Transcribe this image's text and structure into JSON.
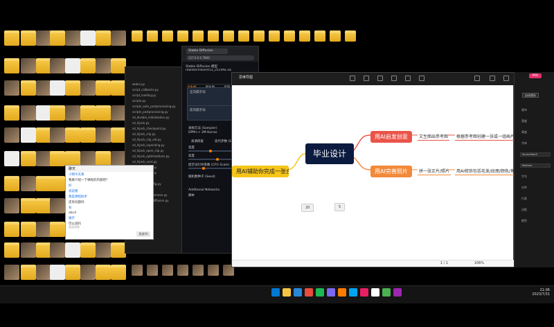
{
  "sd_window": {
    "tab_title": "Stable Diffusion",
    "url": "127.0.0.1:7860",
    "model_label": "Stable Diffusion 模型",
    "model_value": "realisticVisionV51_v51VAE.safetensors [15012c538f]",
    "tabs": [
      "文生图",
      "图生图",
      "后期"
    ],
    "prompt_label": "正向提示词",
    "neg_label": "反向提示词",
    "sampler_label": "采样方法 (Sampler)",
    "sampler_value": "DPM++ 2M Karras",
    "steps_label": "迭代步数 (Steps)",
    "hires_label": "高清修复",
    "refiner_label": "Refiner",
    "width_label": "宽度",
    "height_label": "高度",
    "cfg_label": "提示词引导系数 (CFG Scale)",
    "seed_label": "随机数种子 (Seed)",
    "addnet_label": "Additional Networks",
    "script_label": "脚本"
  },
  "chat": {
    "title": "聊天",
    "lines": [
      {
        "text": "小明今天真",
        "blue": true
      },
      {
        "text": "我来介绍一下课程的内容吧？",
        "blue": false
      },
      {
        "text": "好",
        "blue": true
      },
      {
        "text": "说说看",
        "blue": true
      },
      {
        "text": "我是课程助手",
        "blue": true
      },
      {
        "text": "还有问题吗",
        "blue": false
      },
      {
        "text": "有",
        "blue": true
      },
      {
        "text": "abcd",
        "blue": false
      },
      {
        "text": "展示",
        "blue": true
      },
      {
        "text": "可以说吗",
        "blue": false
      }
    ],
    "input_hint": "发送消息",
    "send_label": "发送(S)"
  },
  "mindmap": {
    "title": "思维导图",
    "center": "毕业设计",
    "left_node": "用AI辅助你完成一张合成",
    "branch1": "用AI启发创意",
    "branch1_sub1": "文生图出参考图",
    "branch1_sub2": "根据参考图创建一张或一组画片",
    "branch2": "用AI完善照片",
    "branch2_sub1": "拼一张正片/照片",
    "branch2_sub2": "用AI修饰包括毛发/纹理/颜色/角",
    "marker1": "20",
    "marker2": "5",
    "zoom": "106%",
    "pages": "1 / 1"
  },
  "props": {
    "badge": "PRO",
    "save_label": "自动保存",
    "items": [
      "画布",
      "宽度",
      "高度",
      "字体",
      "SourceHanS",
      "Medium",
      "字号",
      "对齐",
      "行距",
      "边框",
      "颜色"
    ]
  },
  "explorer": {
    "rows": [
      "webui.py",
      "script_callbacks.py",
      "script_loading.py",
      "scripts.py",
      "scripts_auto_postprocessing.py",
      "scripts_postprocessing.py",
      "sd_disable_initialization.py",
      "sd_hijack.py",
      "sd_hijack_checkpoint.py",
      "sd_hijack_clip.py",
      "sd_hijack_clip_old.py",
      "sd_hijack_inpainting.py",
      "sd_hijack_open_clip.py",
      "sd_hijack_optimizations.py",
      "sd_hijack_unet.py",
      "sd_hijack_utils.py",
      "sd_hijack_xlmr.py",
      "sd_models.py",
      "sd_models_config.py",
      "sd_samplers.py",
      "sd_samplers_common.py",
      "sd_samplers_kdiffusion.py",
      "sd_unet.py",
      "sd_vae.py"
    ]
  },
  "colors": {
    "branch_red": "#ea5449",
    "branch_orange": "#f38a3a",
    "branch_yellow": "#f5c518",
    "center_bg": "#0b1b3f",
    "accent": "#ff7c00"
  },
  "clock": {
    "time": "21:06",
    "date": "2023/7/31"
  }
}
